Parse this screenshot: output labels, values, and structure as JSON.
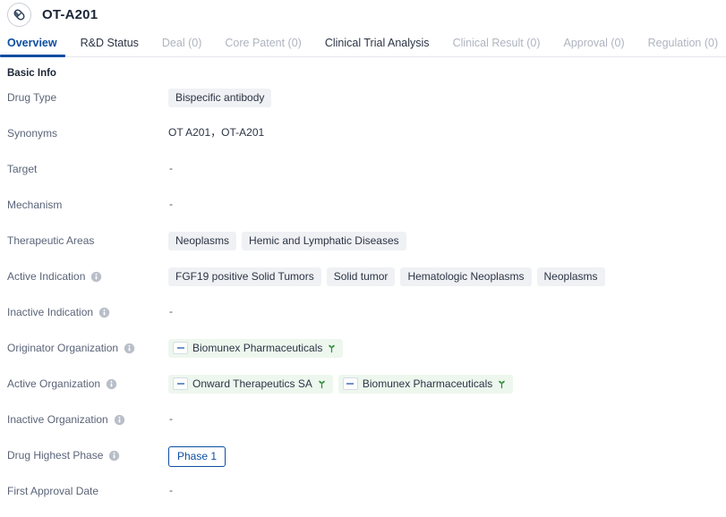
{
  "header": {
    "title": "OT-A201",
    "avatar_icon": "capsule-pill-icon"
  },
  "tabs": [
    {
      "label": "Overview",
      "state": "active"
    },
    {
      "label": "R&D Status",
      "state": "enabled"
    },
    {
      "label": "Deal (0)",
      "state": "disabled"
    },
    {
      "label": "Core Patent (0)",
      "state": "disabled"
    },
    {
      "label": "Clinical Trial Analysis",
      "state": "enabled"
    },
    {
      "label": "Clinical Result (0)",
      "state": "disabled"
    },
    {
      "label": "Approval (0)",
      "state": "disabled"
    },
    {
      "label": "Regulation (0)",
      "state": "disabled"
    }
  ],
  "basic_info": {
    "section_title": "Basic Info",
    "rows": {
      "drug_type": {
        "label": "Drug Type",
        "tags": [
          "Bispecific antibody"
        ]
      },
      "synonyms": {
        "label": "Synonyms",
        "text": "OT A201，OT-A201"
      },
      "target": {
        "label": "Target",
        "value": "-"
      },
      "mechanism": {
        "label": "Mechanism",
        "value": "-"
      },
      "therapeutic_areas": {
        "label": "Therapeutic Areas",
        "tags": [
          "Neoplasms",
          "Hemic and Lymphatic Diseases"
        ]
      },
      "active_indication": {
        "label": "Active Indication",
        "has_info": true,
        "tags": [
          "FGF19 positive Solid Tumors",
          "Solid tumor",
          "Hematologic Neoplasms",
          "Neoplasms"
        ]
      },
      "inactive_indication": {
        "label": "Inactive Indication",
        "has_info": true,
        "value": "-"
      },
      "originator_organization": {
        "label": "Originator Organization",
        "has_info": true,
        "orgs": [
          "Biomunex Pharmaceuticals"
        ]
      },
      "active_organization": {
        "label": "Active Organization",
        "has_info": true,
        "orgs": [
          "Onward Therapeutics SA",
          "Biomunex Pharmaceuticals"
        ]
      },
      "inactive_organization": {
        "label": "Inactive Organization",
        "has_info": true,
        "value": "-"
      },
      "drug_highest_phase": {
        "label": "Drug Highest Phase",
        "has_info": true,
        "badge": "Phase 1"
      },
      "first_approval_date": {
        "label": "First Approval Date",
        "value": "-"
      }
    }
  },
  "colors": {
    "accent_blue": "#0b4ea2",
    "tag_gray": "#f0f1f4",
    "org_green": "#eef7ee",
    "sprout_green": "#2f8f3e",
    "label_gray": "#5a6478",
    "disabled_tab": "#aeb4c0"
  },
  "icons": {
    "info": "info-circle-icon",
    "sprout": "sprout-icon",
    "org_logo": "organization-logo-icon"
  }
}
